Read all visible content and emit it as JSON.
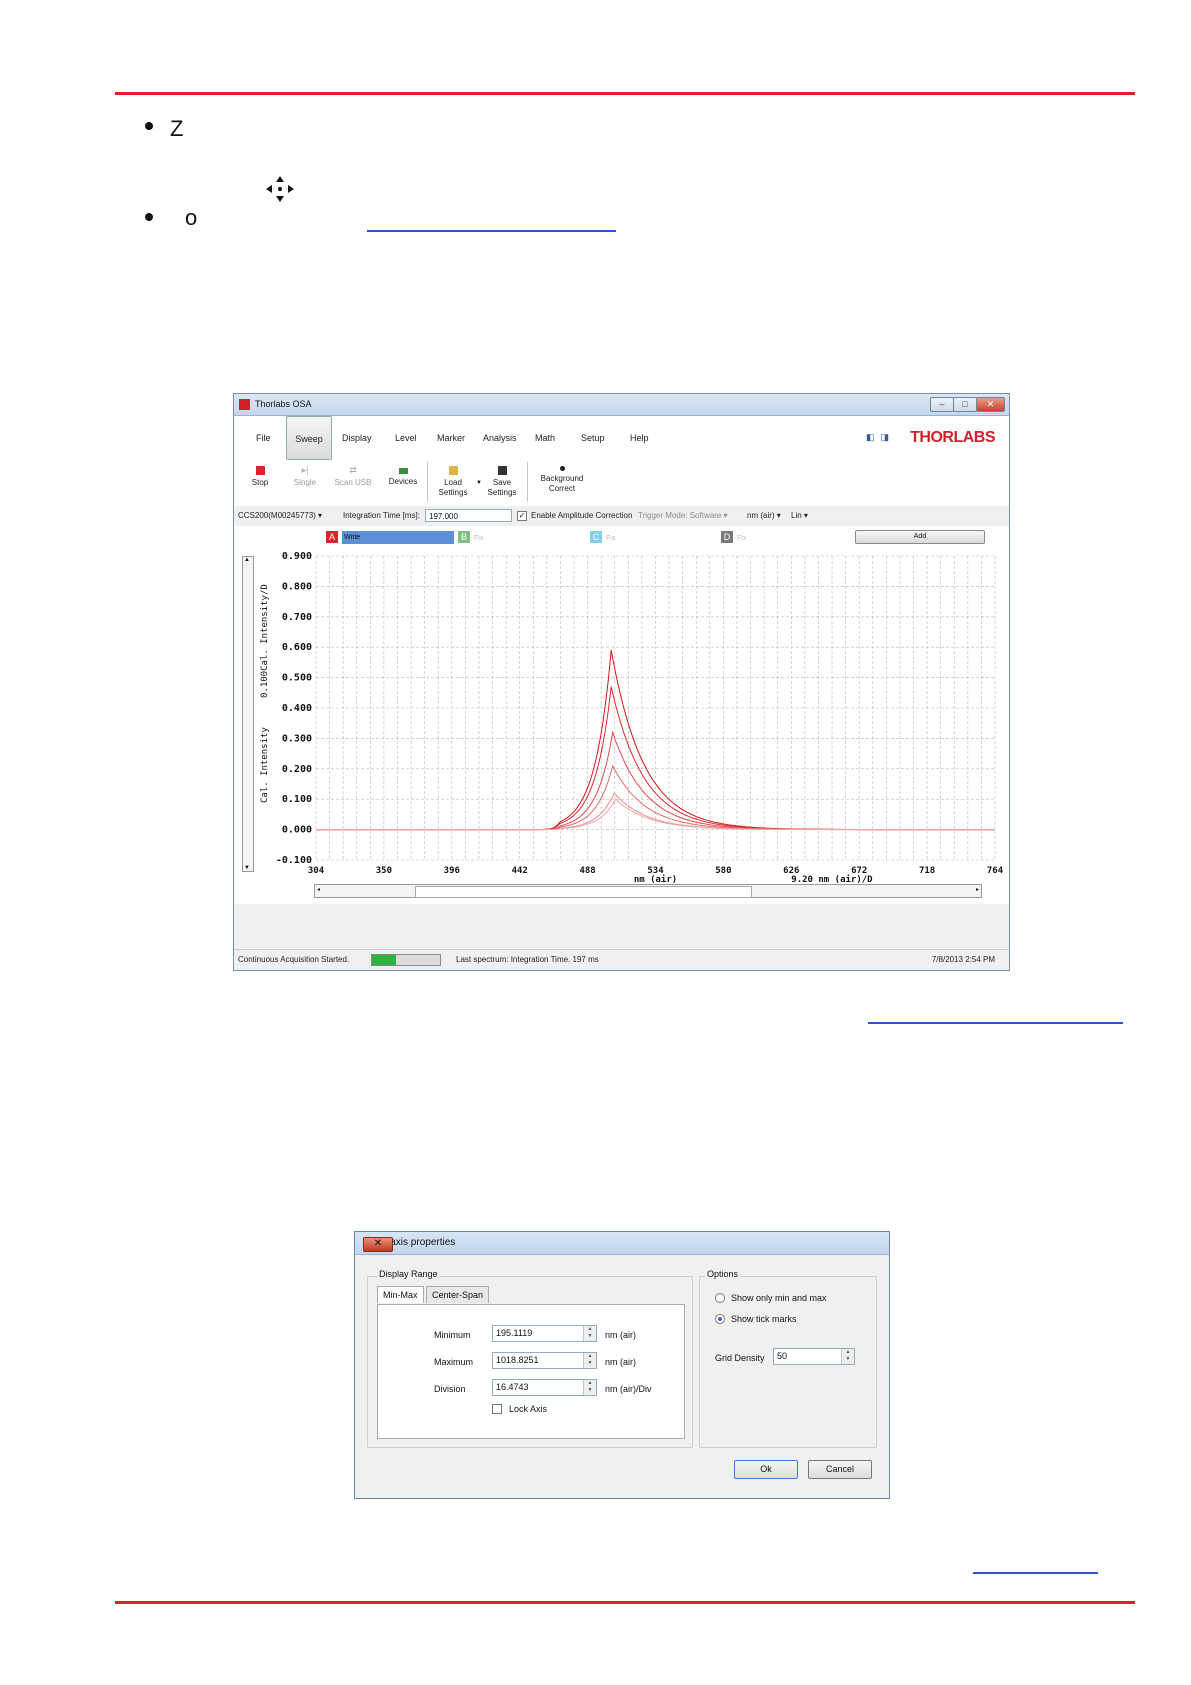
{
  "doc": {
    "bullet1": "Z",
    "bullet2": "o",
    "move_icon": "four-way-arrow-icon"
  },
  "osa": {
    "title": "Thorlabs OSA",
    "menu": [
      "File",
      "Sweep",
      "Display",
      "Level",
      "Marker",
      "Analysis",
      "Math",
      "Setup",
      "Help"
    ],
    "active_menu": "Sweep",
    "brand": "THORLABS",
    "toolbar": {
      "stop": "Stop",
      "single": "Single",
      "scan_usb": "Scan USB",
      "devices": "Devices",
      "load": "Load\nSettings",
      "save": "Save\nSettings",
      "background": "Background\nCorrect"
    },
    "options": {
      "device": "CCS200(M00245773)",
      "integration_label": "Integration Time [ms]:",
      "integration_value": "197.000",
      "amplitude_label": "Enable Amplitude Correction",
      "trigger": "Trigger Mode: Software",
      "unit": "nm (air)",
      "scale": "Lin"
    },
    "traces": [
      {
        "letter": "A",
        "label": "Write",
        "color": "#e0232b"
      },
      {
        "letter": "B",
        "label": "Fix",
        "color": "#7fbf7f"
      },
      {
        "letter": "C",
        "label": "Fix",
        "color": "#7fd0e8"
      },
      {
        "letter": "D",
        "label": "Fix",
        "color": "#7a7a7a"
      }
    ],
    "add_label": "Add",
    "status_left": "Continuous Acquisition Started.",
    "progress": 0.35,
    "status_mid": "Last spectrum: Integration Time. 197 ms",
    "status_right": "7/8/2013 2:54 PM"
  },
  "chart_data": {
    "type": "line",
    "ylabel": "Cal. Intensity",
    "ydiv_label": "0.100Cal. Intensity/D",
    "xlabel": "nm (air)",
    "xdiv_label": "9.20 nm (air)/D",
    "xlim": [
      304,
      764
    ],
    "ylim": [
      -0.1,
      0.9
    ],
    "x_ticks": [
      304,
      350,
      396,
      442,
      488,
      534,
      580,
      626,
      672,
      718,
      764
    ],
    "y_ticks": [
      "0.900",
      "0.800",
      "0.700",
      "0.600",
      "0.500",
      "0.400",
      "0.300",
      "0.200",
      "0.100",
      "0.000",
      "-0.100"
    ],
    "series": [
      {
        "peak_x": 504,
        "peak_y": 0.59
      },
      {
        "peak_x": 504,
        "peak_y": 0.47
      },
      {
        "peak_x": 505,
        "peak_y": 0.32
      },
      {
        "peak_x": 505,
        "peak_y": 0.21
      },
      {
        "peak_x": 506,
        "peak_y": 0.12
      },
      {
        "peak_x": 507,
        "peak_y": 0.1
      }
    ],
    "grid": true
  },
  "dialog": {
    "title": "Set X axis properties",
    "close_glyph": "✕",
    "display_range": "Display Range",
    "tabs": [
      "Min-Max",
      "Center-Span"
    ],
    "minimum_label": "Minimum",
    "minimum_value": "195.1119",
    "minimum_unit": "nm (air)",
    "maximum_label": "Maximum",
    "maximum_value": "1018.8251",
    "maximum_unit": "nm (air)",
    "division_label": "Division",
    "division_value": "16.4743",
    "division_unit": "nm (air)/Div",
    "lock_axis": "Lock Axis",
    "options": "Options",
    "opt_minmax": "Show only min and max",
    "opt_ticks": "Show tick marks",
    "grid_label": "Grid Density",
    "grid_value": "50",
    "ok": "Ok",
    "cancel": "Cancel"
  }
}
